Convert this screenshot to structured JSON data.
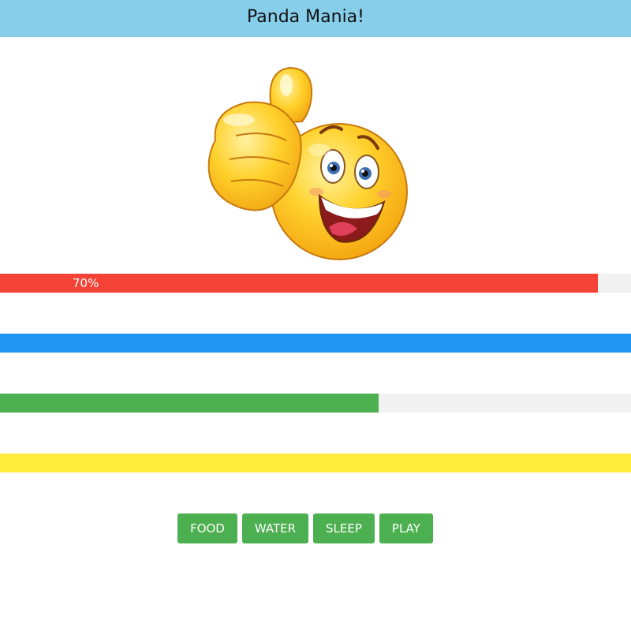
{
  "app": {
    "title": "Panda Mania!"
  },
  "mood_image": {
    "icon": "thumbs-up-smiley-icon"
  },
  "status_bars": [
    {
      "id": "food",
      "percent": 94.75,
      "label": "70%",
      "color": "#F44336"
    },
    {
      "id": "water",
      "percent": 100,
      "label": "",
      "color": "#2196F3"
    },
    {
      "id": "sleep",
      "percent": 60,
      "label": "",
      "color": "#4CAF50"
    },
    {
      "id": "play",
      "percent": 100,
      "label": "",
      "color": "#FFEB3B"
    }
  ],
  "actions": {
    "food_label": "FOOD",
    "water_label": "WATER",
    "sleep_label": "SLEEP",
    "play_label": "PLAY"
  },
  "colors": {
    "header_bg": "#87CEEB",
    "track": "#F1F1F1",
    "button": "#4CAF50"
  }
}
